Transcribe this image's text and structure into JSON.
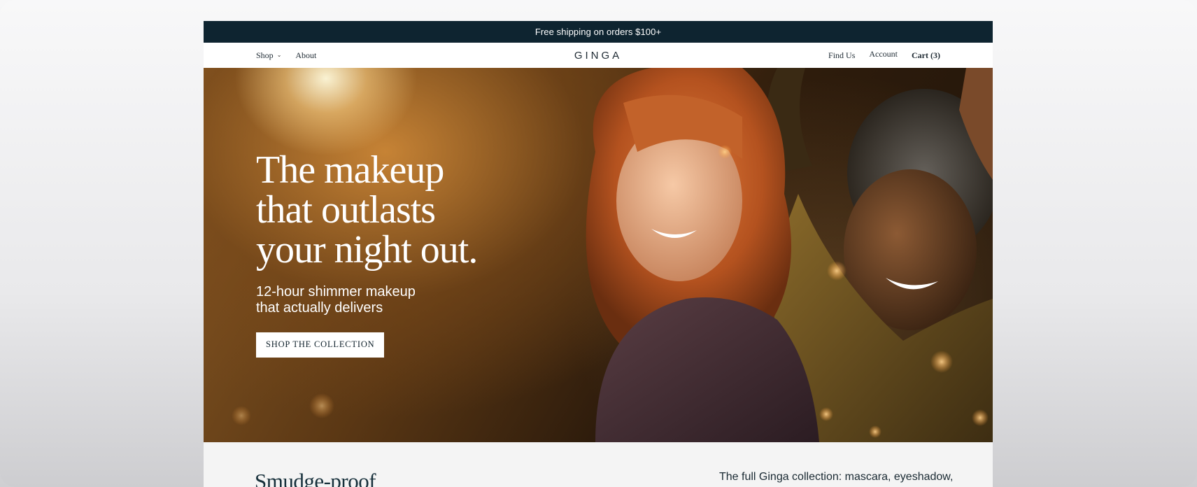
{
  "promo_bar": {
    "text": "Free shipping on orders $100+"
  },
  "nav": {
    "left": [
      {
        "label": "Shop",
        "has_dropdown": true,
        "icon": "chevron-down-icon"
      },
      {
        "label": "About"
      }
    ],
    "logo": "GINGA",
    "right": [
      {
        "label": "Find Us"
      },
      {
        "label": "Account"
      },
      {
        "label": "Cart (3)"
      }
    ]
  },
  "hero": {
    "headline_lines": [
      "The makeup",
      "that outlasts",
      "your night out."
    ],
    "subhead_lines": [
      "12-hour shimmer makeup",
      "that actually delivers"
    ],
    "cta_label": "SHOP THE COLLECTION",
    "image": "two-women-in-sequin-dresses-photo"
  },
  "below": {
    "heading": "Smudge-proof",
    "blurb": "The full Ginga collection: mascara, eyeshadow,"
  },
  "colors": {
    "promo_bg": "#0e2430",
    "nav_bg": "#ffffff",
    "text_dark": "#1e2a33",
    "section_bg": "#f4f4f4",
    "cta_bg": "#ffffff"
  }
}
